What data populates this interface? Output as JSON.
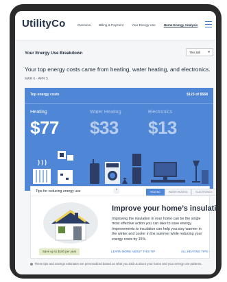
{
  "header": {
    "logo": "UtilityCo",
    "nav": [
      "Overview",
      "Billing & Payment",
      "Your Energy Use",
      "Home Energy Analysis"
    ],
    "active_nav": "Home Energy Analysis"
  },
  "breakdown": {
    "title": "Your Energy Use Breakdown",
    "bill_select": "This Bill",
    "headline": "Your top energy costs came from heating, water heating, and electronics.",
    "date_range": "MAR 6 - APR 5"
  },
  "top_costs": {
    "title": "Top energy costs",
    "total": "$123 of $558",
    "categories": [
      {
        "label": "Heating",
        "amount": "$77"
      },
      {
        "label": "Water Heating",
        "amount": "$33"
      },
      {
        "label": "Electronics",
        "amount": "$13"
      }
    ]
  },
  "tips": {
    "title": "Tips for reducing energy use",
    "tabs": [
      "HEATING",
      "WATER HEATING",
      "ELECTRONICS"
    ],
    "heading": "Improve your home’s insulation",
    "body": "Improving the insulation in your home can be the single most effective action you can take to save energy. Improvements to insulation can help you stay warmer in the winter and cooler in the summer while reducing your energy costs by 15%.",
    "savings": "Save up to $100 per year",
    "learn_more": "LEARN MORE ABOUT THIS TIP",
    "all_tips": "ALL HEATING TIPS"
  },
  "footnote": "These tips and savings estimates are personalized based on what you told us about your home and your energy use patterns.",
  "colors": {
    "accent_blue": "#4f86d6",
    "link_blue": "#2f6fd0",
    "savings_green": "#e3edc9"
  }
}
